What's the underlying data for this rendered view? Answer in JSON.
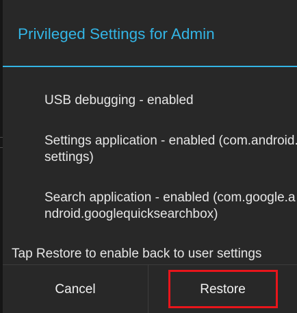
{
  "dialog": {
    "title": "Privileged Settings for Admin",
    "items": [
      {
        "label": "USB debugging - enabled"
      },
      {
        "label": "Settings application - enabled (com.android.settings)"
      },
      {
        "label": "Search application - enabled (com.google.android.googlequicksearchbox)"
      }
    ],
    "message": "Tap Restore to enable back to user settings",
    "buttons": {
      "cancel_label": "Cancel",
      "restore_label": "Restore"
    }
  },
  "colors": {
    "accent": "#33b5e5",
    "dialog_background": "#282828",
    "highlight_border": "#e8151b"
  }
}
